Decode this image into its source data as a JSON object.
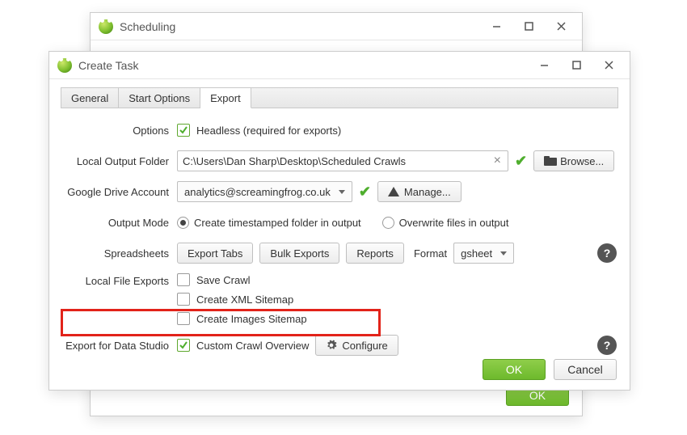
{
  "back_window": {
    "title": "Scheduling",
    "ok": "OK"
  },
  "front_window": {
    "title": "Create Task"
  },
  "tabs": {
    "general": "General",
    "start_options": "Start Options",
    "export": "Export"
  },
  "labels": {
    "options": "Options",
    "local_output": "Local Output Folder",
    "gdrive": "Google Drive Account",
    "output_mode": "Output Mode",
    "spreadsheets": "Spreadsheets",
    "local_exports": "Local File Exports",
    "data_studio": "Export for Data Studio"
  },
  "options": {
    "headless": "Headless (required for exports)"
  },
  "local_output": {
    "path": "C:\\Users\\Dan Sharp\\Desktop\\Scheduled Crawls",
    "browse": "Browse..."
  },
  "gdrive": {
    "account": "analytics@screamingfrog.co.uk",
    "manage": "Manage..."
  },
  "output_mode": {
    "timestamped": "Create timestamped folder in output",
    "overwrite": "Overwrite files in output"
  },
  "spreadsheets": {
    "export_tabs": "Export Tabs",
    "bulk_exports": "Bulk Exports",
    "reports": "Reports",
    "format_label": "Format",
    "format_value": "gsheet"
  },
  "local_exports": {
    "save_crawl": "Save Crawl",
    "xml_sitemap": "Create XML Sitemap",
    "images_sitemap": "Create Images Sitemap"
  },
  "data_studio": {
    "custom_overview": "Custom Crawl Overview",
    "configure": "Configure"
  },
  "footer": {
    "ok": "OK",
    "cancel": "Cancel"
  },
  "help": "?"
}
